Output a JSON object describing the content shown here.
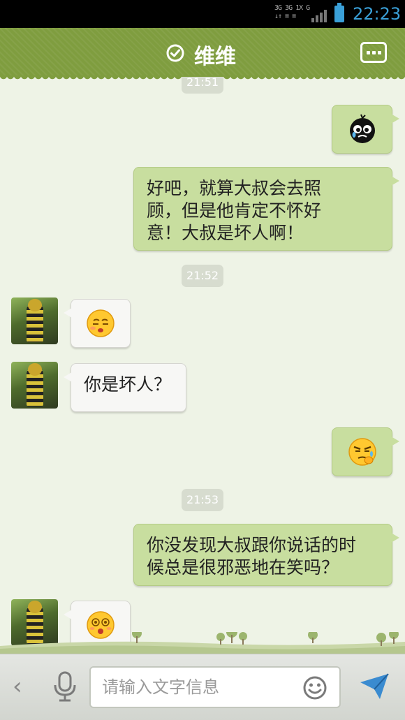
{
  "status_bar": {
    "network_top": "3G 3G 1X  G",
    "network_bottom": "↓↑ ≡ ≡",
    "time": "22:23"
  },
  "header": {
    "title": "维维",
    "verified_icon": "check-circle-icon",
    "menu_icon": "more-dots-icon"
  },
  "messages": [
    {
      "type": "timestamp",
      "text": "21:51"
    },
    {
      "type": "emoji",
      "side": "out",
      "icon": "crying-black-bomb-emoji"
    },
    {
      "type": "text",
      "side": "out",
      "lines": [
        "好吧，就算大叔会去照",
        "顾，但是他肯定不怀好",
        "意！大叔是坏人啊！"
      ]
    },
    {
      "type": "timestamp",
      "text": "21:52"
    },
    {
      "type": "emoji",
      "side": "in",
      "icon": "sleepy-face-emoji"
    },
    {
      "type": "text",
      "side": "in",
      "lines": [
        "你是坏人？"
      ]
    },
    {
      "type": "emoji",
      "side": "out",
      "icon": "smug-thinking-face-emoji"
    },
    {
      "type": "timestamp",
      "text": "21:53"
    },
    {
      "type": "text",
      "side": "out",
      "lines": [
        "你没发现大叔跟你说话的时",
        "候总是很邪恶地在笑吗？"
      ]
    },
    {
      "type": "emoji",
      "side": "in",
      "icon": "dizzy-face-emoji"
    }
  ],
  "input_bar": {
    "back_glyph": "‹",
    "placeholder": "请输入文字信息",
    "mic_icon": "microphone-icon",
    "emoji_icon": "smiley-icon",
    "send_icon": "send-arrow-icon"
  },
  "colors": {
    "header": "#7f9d3f",
    "outgoing_bubble": "#c8de9f",
    "incoming_bubble": "#f7f7f5",
    "background": "#eef3e6",
    "accent": "#3aa0d8"
  }
}
